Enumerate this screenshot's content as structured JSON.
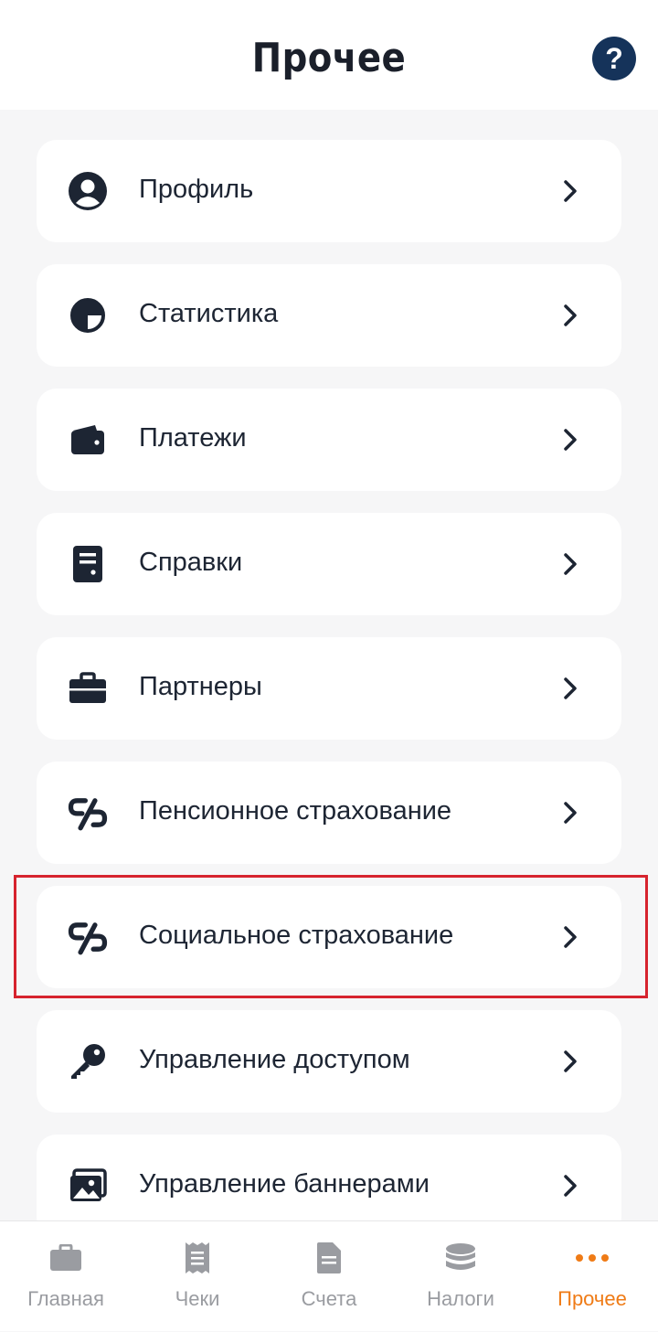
{
  "header": {
    "title": "Прочее",
    "help_label": "?"
  },
  "menu": [
    {
      "label": "Профиль",
      "icon": "profile-icon"
    },
    {
      "label": "Статистика",
      "icon": "pie-chart-icon"
    },
    {
      "label": "Платежи",
      "icon": "wallet-icon"
    },
    {
      "label": "Справки",
      "icon": "document-icon"
    },
    {
      "label": "Партнеры",
      "icon": "briefcase-icon"
    },
    {
      "label": "Пенсионное страхование",
      "icon": "sf-logo-icon"
    },
    {
      "label": "Социальное страхование",
      "icon": "sf-logo-icon"
    },
    {
      "label": "Управление доступом",
      "icon": "key-icon"
    },
    {
      "label": "Управление баннерами",
      "icon": "image-icon"
    }
  ],
  "tabbar": [
    {
      "label": "Главная",
      "icon": "briefcase-icon",
      "active": false
    },
    {
      "label": "Чеки",
      "icon": "receipt-icon",
      "active": false
    },
    {
      "label": "Счета",
      "icon": "document-icon",
      "active": false
    },
    {
      "label": "Налоги",
      "icon": "coins-stack-icon",
      "active": false
    },
    {
      "label": "Прочее",
      "icon": "more-dots-icon",
      "active": true
    }
  ],
  "colors": {
    "accent": "#ef7b16",
    "text_dark": "#1d2533",
    "help_bg": "#15335a",
    "highlight": "#d6232e",
    "inactive": "#9a9ca1",
    "background": "#f6f6f7"
  }
}
